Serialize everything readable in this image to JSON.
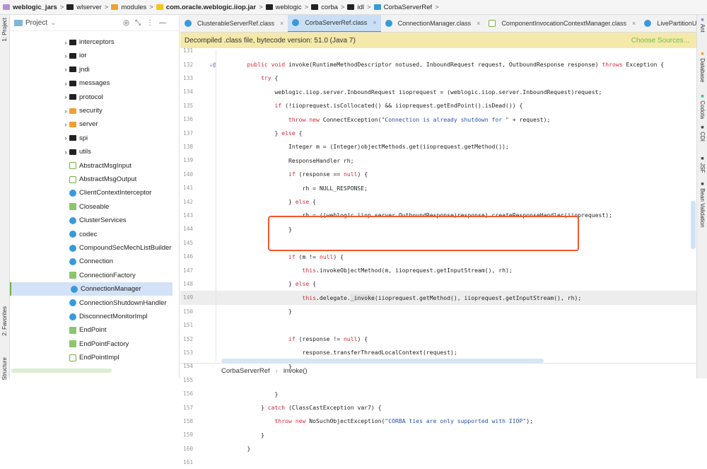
{
  "breadcrumb": [
    "weblogic_jars",
    "wlserver",
    "modules",
    "com.oracle.weblogic.iiop.jar",
    "weblogic",
    "corba",
    "idl",
    "CorbaServerRef"
  ],
  "left_strip": {
    "project": "1: Project",
    "favorites": "2: Favorites",
    "structure": "Structure"
  },
  "project_panel": {
    "title": "Project",
    "items": [
      {
        "label": "interceptors",
        "kind": "folder"
      },
      {
        "label": "ior",
        "kind": "folder"
      },
      {
        "label": "jndi",
        "kind": "folder"
      },
      {
        "label": "messages",
        "kind": "folder"
      },
      {
        "label": "protocol",
        "kind": "folder"
      },
      {
        "label": "security",
        "kind": "folder-orange"
      },
      {
        "label": "server",
        "kind": "folder-orange"
      },
      {
        "label": "spi",
        "kind": "folder"
      },
      {
        "label": "utils",
        "kind": "folder"
      },
      {
        "label": "AbstractMsgInput",
        "kind": "abstract"
      },
      {
        "label": "AbstractMsgOutput",
        "kind": "abstract"
      },
      {
        "label": "ClientContextInterceptor",
        "kind": "class"
      },
      {
        "label": "Closeable",
        "kind": "interface"
      },
      {
        "label": "ClusterServices",
        "kind": "class"
      },
      {
        "label": "codec",
        "kind": "class"
      },
      {
        "label": "CompoundSecMechListBuilder",
        "kind": "class"
      },
      {
        "label": "Connection",
        "kind": "class"
      },
      {
        "label": "ConnectionFactory",
        "kind": "interface"
      },
      {
        "label": "ConnectionManager",
        "kind": "class",
        "selected": true
      },
      {
        "label": "ConnectionShutdownHandler",
        "kind": "class"
      },
      {
        "label": "DisconnectMonitorImpl",
        "kind": "class"
      },
      {
        "label": "EndPoint",
        "kind": "interface"
      },
      {
        "label": "EndPointFactory",
        "kind": "interface"
      },
      {
        "label": "EndPointImpl",
        "kind": "abstract"
      }
    ]
  },
  "tabs": [
    {
      "label": "ClusterableServerRef.class"
    },
    {
      "label": "CorbaServerRef.class",
      "active": true
    },
    {
      "label": "ConnectionManager.class"
    },
    {
      "label": "ComponentInvocationContextManager.class"
    },
    {
      "label": "LivePartitionUtility.class"
    }
  ],
  "tabs_overflow": "5",
  "banner": {
    "text": "Decompiled .class file, bytecode version: 51.0 (Java 7)",
    "action": "Choose Sources..."
  },
  "code": [
    {
      "n": "131",
      "i": 0,
      "t": []
    },
    {
      "n": "132",
      "i": 1,
      "t": [
        [
          "public void ",
          "kw"
        ],
        [
          "invoke(RuntimeMethodDescriptor notused, InboundRequest request, OutboundResponse response) ",
          ""
        ],
        [
          "throws ",
          "kw"
        ],
        [
          "Exception {",
          ""
        ]
      ]
    },
    {
      "n": "133",
      "i": 2,
      "t": [
        [
          "try ",
          "kw"
        ],
        [
          "{",
          ""
        ]
      ]
    },
    {
      "n": "134",
      "i": 3,
      "t": [
        [
          "weblogic.iiop.server.InboundRequest iioprequest = (weblogic.iiop.server.InboundRequest)request;",
          ""
        ]
      ]
    },
    {
      "n": "135",
      "i": 3,
      "t": [
        [
          "if ",
          "kw"
        ],
        [
          "(!iioprequest.isCollocated() && iioprequest.getEndPoint().isDead()) {",
          ""
        ]
      ]
    },
    {
      "n": "136",
      "i": 4,
      "t": [
        [
          "throw new ",
          "kw"
        ],
        [
          "ConnectException(",
          ""
        ],
        [
          "\"Connection is already shutdown for \"",
          "str"
        ],
        [
          " + request);",
          ""
        ]
      ]
    },
    {
      "n": "137",
      "i": 3,
      "t": [
        [
          "} ",
          ""
        ],
        [
          "else ",
          "kw"
        ],
        [
          "{",
          ""
        ]
      ]
    },
    {
      "n": "138",
      "i": 4,
      "t": [
        [
          "Integer m = (Integer)objectMethods.get(iioprequest.getMethod());",
          ""
        ]
      ]
    },
    {
      "n": "139",
      "i": 4,
      "t": [
        [
          "ResponseHandler rh;",
          ""
        ]
      ]
    },
    {
      "n": "140",
      "i": 4,
      "t": [
        [
          "if ",
          "kw"
        ],
        [
          "(response == ",
          ""
        ],
        [
          "null",
          "kw"
        ],
        [
          ") {",
          ""
        ]
      ]
    },
    {
      "n": "141",
      "i": 5,
      "t": [
        [
          "rh = NULL_RESPONSE;",
          ""
        ]
      ]
    },
    {
      "n": "142",
      "i": 4,
      "t": [
        [
          "} ",
          ""
        ],
        [
          "else ",
          "kw"
        ],
        [
          "{",
          ""
        ]
      ]
    },
    {
      "n": "143",
      "i": 5,
      "t": [
        [
          "rh = ((weblogic.iiop.server.OutboundResponse)response).createResponseHandler(iioprequest);",
          ""
        ]
      ]
    },
    {
      "n": "144",
      "i": 4,
      "t": [
        [
          "}",
          ""
        ]
      ]
    },
    {
      "n": "145",
      "i": 0,
      "t": []
    },
    {
      "n": "146",
      "i": 4,
      "t": [
        [
          "if ",
          "kw"
        ],
        [
          "(m != ",
          ""
        ],
        [
          "null",
          "kw"
        ],
        [
          ") {",
          ""
        ]
      ]
    },
    {
      "n": "147",
      "i": 5,
      "t": [
        [
          "this",
          "kw"
        ],
        [
          ".invokeObjectMethod(m, iioprequest.getInputStream(), rh);",
          ""
        ]
      ]
    },
    {
      "n": "148",
      "i": 4,
      "t": [
        [
          "} ",
          ""
        ],
        [
          "else ",
          "kw"
        ],
        [
          "{",
          ""
        ]
      ]
    },
    {
      "n": "149",
      "i": 5,
      "cur": true,
      "t": [
        [
          "this",
          "kw"
        ],
        [
          ".delegate.",
          ""
        ],
        [
          "_invoke",
          "hl"
        ],
        [
          "(iioprequest.getMethod(), iioprequest.getInputStream(), rh);",
          ""
        ]
      ]
    },
    {
      "n": "150",
      "i": 4,
      "t": [
        [
          "}",
          ""
        ]
      ]
    },
    {
      "n": "151",
      "i": 0,
      "t": []
    },
    {
      "n": "152",
      "i": 4,
      "t": [
        [
          "if ",
          "kw"
        ],
        [
          "(response != ",
          ""
        ],
        [
          "null",
          "kw"
        ],
        [
          ") {",
          ""
        ]
      ]
    },
    {
      "n": "153",
      "i": 5,
      "t": [
        [
          "response.transferThreadLocalContext(request);",
          ""
        ]
      ]
    },
    {
      "n": "154",
      "i": 4,
      "t": [
        [
          "}",
          ""
        ]
      ]
    },
    {
      "n": "155",
      "i": 0,
      "t": []
    },
    {
      "n": "156",
      "i": 3,
      "t": [
        [
          "}",
          ""
        ]
      ]
    },
    {
      "n": "157",
      "i": 2,
      "t": [
        [
          "} ",
          ""
        ],
        [
          "catch ",
          "kw"
        ],
        [
          "(ClassCastException var7) {",
          ""
        ]
      ]
    },
    {
      "n": "158",
      "i": 3,
      "t": [
        [
          "throw new ",
          "kw"
        ],
        [
          "NoSuchObjectException(",
          ""
        ],
        [
          "\"CORBA ties are only supported with IIOP\"",
          "str"
        ],
        [
          ");",
          ""
        ]
      ]
    },
    {
      "n": "159",
      "i": 2,
      "t": [
        [
          "}",
          ""
        ]
      ]
    },
    {
      "n": "160",
      "i": 1,
      "t": [
        [
          "}",
          ""
        ]
      ]
    },
    {
      "n": "161",
      "i": 0,
      "t": []
    }
  ],
  "editor_breadcrumb": [
    "CorbaServerRef",
    "invoke()"
  ],
  "right_strip": [
    "Ant",
    "Database",
    "Codota",
    "CDI",
    "JSF",
    "Bean Validation"
  ]
}
